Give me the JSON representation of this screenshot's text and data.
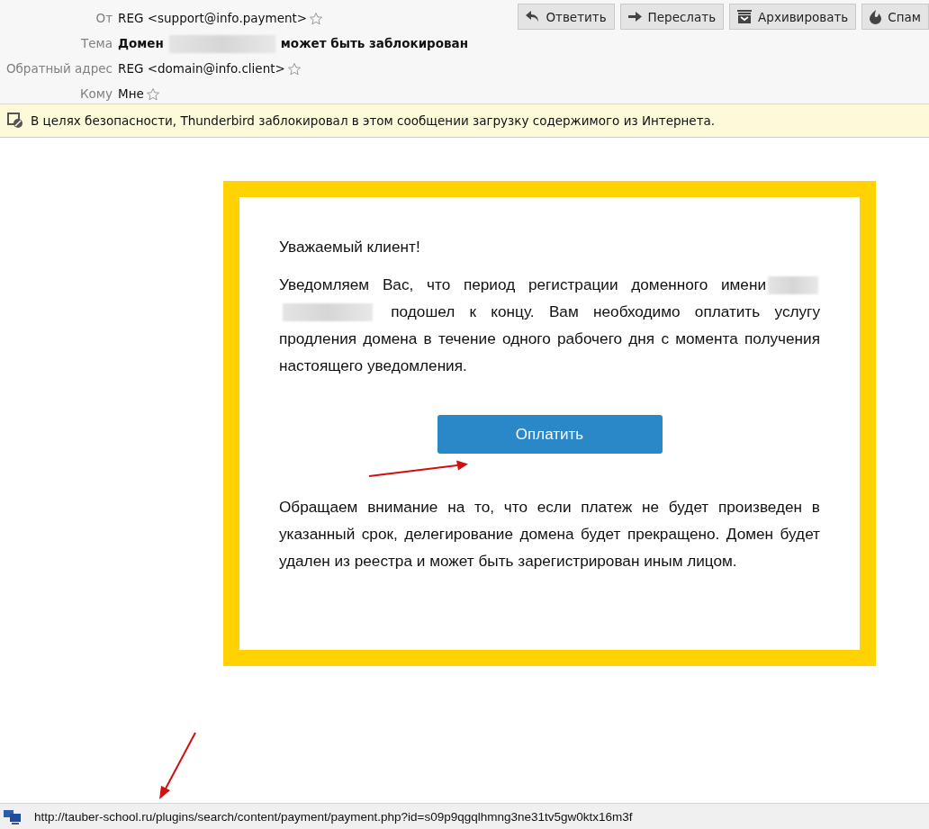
{
  "header": {
    "fields": [
      {
        "label": "От",
        "value": "REG <support@info.payment>",
        "kind": "address",
        "starred": false
      },
      {
        "label": "Тема",
        "before": "Домен",
        "after": "может быть заблокирован",
        "kind": "subject"
      },
      {
        "label": "Обратный адрес",
        "value": "REG <domain@info.client>",
        "kind": "address",
        "starred": false
      },
      {
        "label": "Кому",
        "value": "Мне",
        "kind": "address",
        "starred": false
      }
    ],
    "actions": [
      {
        "label": "Ответить",
        "kind": "reply"
      },
      {
        "label": "Переслать",
        "kind": "forward"
      },
      {
        "label": "Архивировать",
        "kind": "archive"
      },
      {
        "label": "Спам",
        "kind": "spam"
      }
    ]
  },
  "notice": "В целях безопасности, Thunderbird заблокировал в этом сообщении загрузку содержимого из Интернета.",
  "letter": {
    "greeting": "Уважаемый клиент!",
    "intro_before": "Уведомляем Вас, что период регистрации доменного имени",
    "intro_after": "подошел к концу. Вам необходимо оплатить услугу продления домена в течение одного рабочего дня с момента получения настоящего уведомления.",
    "button": "Оплатить",
    "warning": "Обращаем внимание на то, что если платеж не будет произведен в указанный срок, делегирование домена будет прекращено. Домен будет удален из реестра и может быть зарегистрирован иным лицом."
  },
  "status_bar": {
    "url": "http://tauber-school.ru/plugins/search/content/payment/payment.php?id=s09p9qgqlhmng3ne31tv5gw0ktx16m3f"
  }
}
